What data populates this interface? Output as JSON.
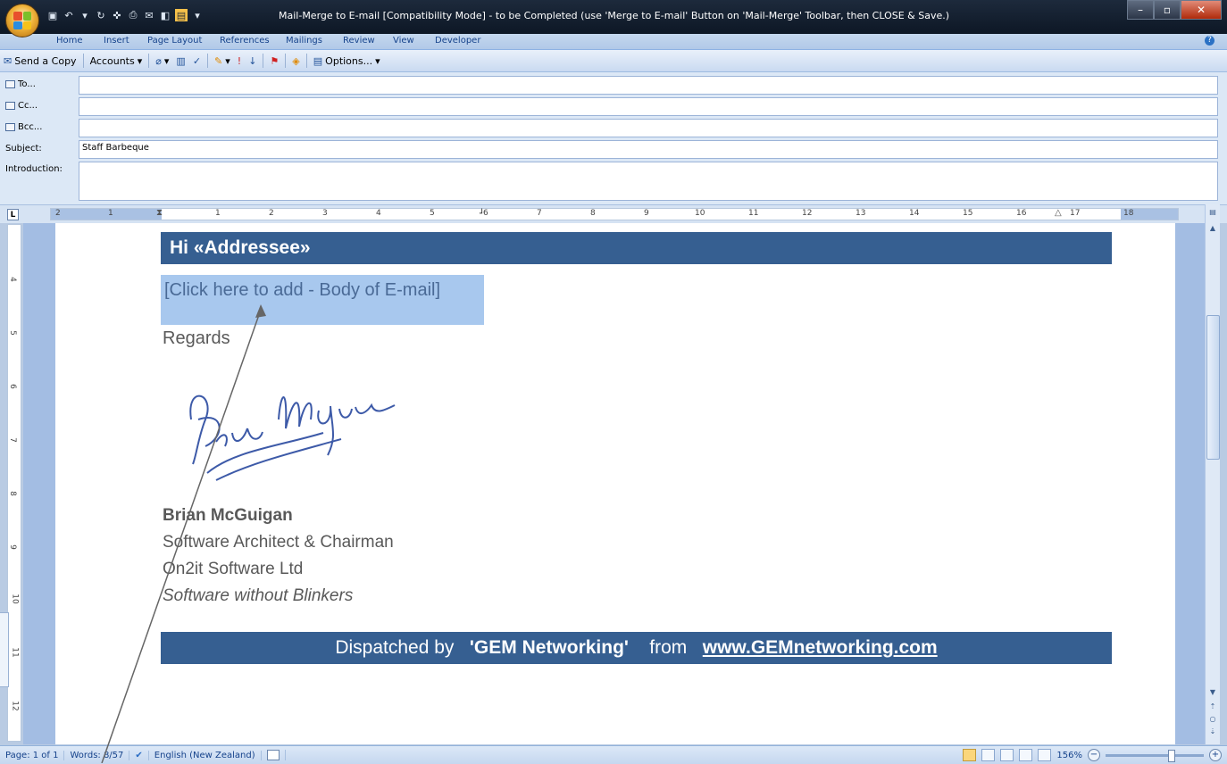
{
  "window": {
    "title": "Mail-Merge to E-mail [Compatibility Mode] - to be Completed (use 'Merge to E-mail' Button on 'Mail-Merge' Toolbar, then CLOSE & Save.)",
    "minimize": "–",
    "maximize": "▫",
    "close": "✕"
  },
  "ribbon_tabs": [
    "Home",
    "Insert",
    "Page Layout",
    "References",
    "Mailings",
    "Review",
    "View",
    "Developer"
  ],
  "toolbar": {
    "send_copy": "Send a Copy",
    "accounts": "Accounts",
    "options": "Options..."
  },
  "fields": {
    "to_label": "To...",
    "cc_label": "Cc...",
    "bcc_label": "Bcc...",
    "subject_label": "Subject:",
    "subject_value": "Staff Barbeque",
    "intro_label": "Introduction:"
  },
  "ruler": {
    "numbers": [
      "2",
      "1",
      "1",
      "2",
      "3",
      "4",
      "5",
      "6",
      "7",
      "8",
      "9",
      "10",
      "11",
      "12",
      "13",
      "14",
      "15",
      "16",
      "17",
      "18"
    ],
    "vnumbers": [
      "4",
      "5",
      "6",
      "7",
      "8",
      "9",
      "10",
      "11",
      "12"
    ],
    "corner": "L"
  },
  "document": {
    "greeting": "Hi «Addressee»",
    "body_placeholder": "[Click here to add - Body of E-mail]",
    "regards": "Regards",
    "sig_name": "Brian McGuigan",
    "sig_title": "Software Architect & Chairman",
    "sig_company": "On2it Software  Ltd",
    "sig_tagline": "Software without Blinkers",
    "dispatch_prefix": "Dispatched by",
    "dispatch_org": "'GEM Networking'",
    "dispatch_from": "from",
    "dispatch_url": "www.GEMnetworking.com"
  },
  "status": {
    "page": "Page: 1 of 1",
    "words": "Words: 8/57",
    "language": "English (New Zealand)",
    "zoom": "156%"
  },
  "colors": {
    "banner": "#365f91",
    "placeholder_highlight": "#a8c8ee",
    "ui_blue": "#15428b"
  }
}
